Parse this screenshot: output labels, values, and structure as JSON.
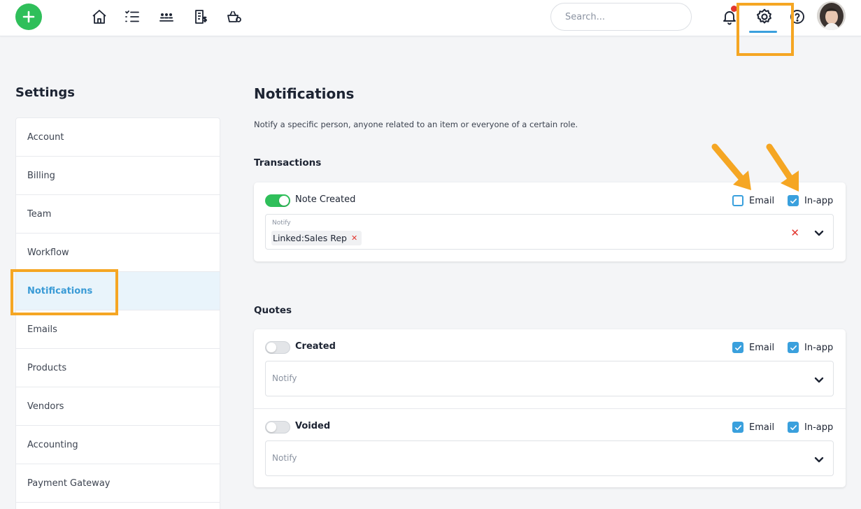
{
  "header": {
    "search_placeholder": "Search..."
  },
  "sidebar": {
    "title": "Settings",
    "items": [
      {
        "label": "Account"
      },
      {
        "label": "Billing"
      },
      {
        "label": "Team"
      },
      {
        "label": "Workflow"
      },
      {
        "label": "Notifications",
        "active": true
      },
      {
        "label": "Emails"
      },
      {
        "label": "Products"
      },
      {
        "label": "Vendors"
      },
      {
        "label": "Accounting"
      },
      {
        "label": "Payment Gateway"
      }
    ]
  },
  "main": {
    "title": "Notifications",
    "description": "Notify a specific person, anyone related to an item or everyone of a certain role.",
    "sections": [
      {
        "title": "Transactions",
        "rules": [
          {
            "name": "Note Created",
            "enabled": true,
            "email_label": "Email",
            "email_checked": false,
            "inapp_label": "In-app",
            "inapp_checked": true,
            "notify_label": "Notify",
            "tag": "Linked:Sales Rep"
          }
        ]
      },
      {
        "title": "Quotes",
        "rules": [
          {
            "name": "Created",
            "enabled": false,
            "email_label": "Email",
            "email_checked": true,
            "inapp_label": "In-app",
            "inapp_checked": true,
            "notify_placeholder": "Notify"
          },
          {
            "name": "Voided",
            "enabled": false,
            "email_label": "Email",
            "email_checked": true,
            "inapp_label": "In-app",
            "inapp_checked": true,
            "notify_placeholder": "Notify"
          }
        ]
      }
    ]
  },
  "colors": {
    "accent": "#3aa0dd",
    "toggle_on": "#2fbf5a",
    "highlight": "#f5a623",
    "danger": "#e2362f"
  },
  "icons": [
    "plus-icon",
    "home-icon",
    "list-icon",
    "team-icon",
    "invoice-icon",
    "products-icon",
    "bell-icon",
    "gear-icon",
    "help-icon",
    "chevron-down-icon"
  ]
}
